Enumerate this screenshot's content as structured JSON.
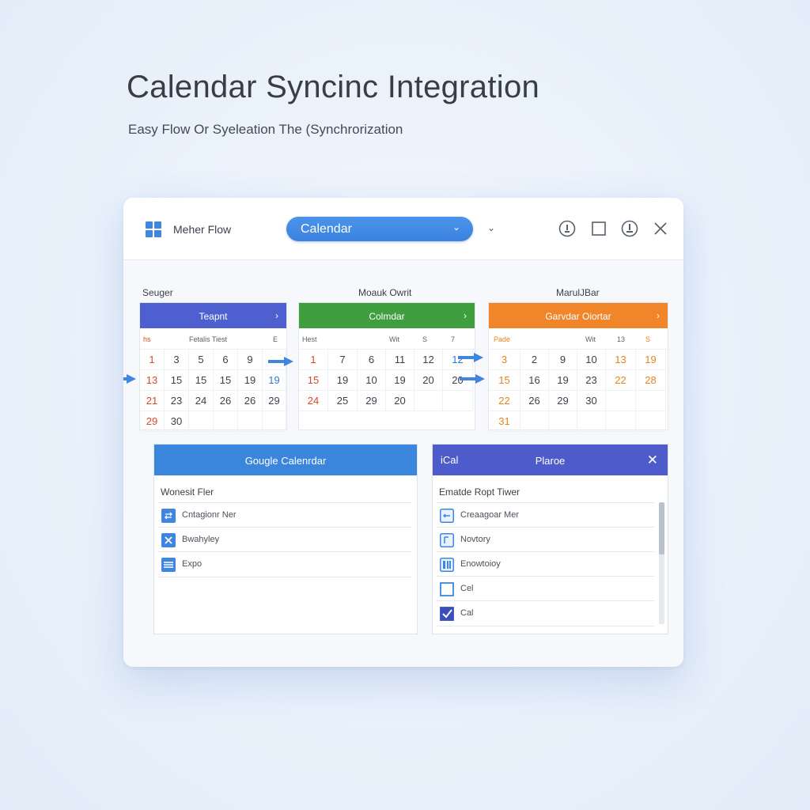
{
  "hero": {
    "title": "Calendar Syncinc Integration",
    "subtitle": "Easy Flow Or Syeleation The (Synchrorization"
  },
  "window": {
    "app_name": "Meher Flow",
    "calendar_select": "Calendar",
    "toolbar_icons": [
      "info-icon",
      "maximize-icon",
      "settings-icon",
      "close-icon"
    ]
  },
  "calendars": [
    {
      "caption": "Seuger",
      "header": "Teapnt",
      "header_color": "#4e5fcf",
      "dow": [
        "hs",
        "Fetalis Tiest",
        "E"
      ],
      "rows": [
        [
          "1",
          "3",
          "5",
          "6",
          "9",
          ""
        ],
        [
          "13",
          "15",
          "15",
          "15",
          "19",
          "19"
        ],
        [
          "21",
          "23",
          "24",
          "26",
          "26",
          "29"
        ],
        [
          "29",
          "30",
          "",
          "",
          "",
          ""
        ]
      ]
    },
    {
      "caption": "Moauk Owrit",
      "header": "Colmdar",
      "header_color": "#3f9f3f",
      "dow": [
        "Hest",
        "Wit",
        "S",
        "7"
      ],
      "rows": [
        [
          "1",
          "7",
          "6",
          "11",
          "12",
          "12"
        ],
        [
          "15",
          "19",
          "10",
          "19",
          "20",
          "20"
        ],
        [
          "24",
          "25",
          "29",
          "20",
          "",
          ""
        ]
      ]
    },
    {
      "caption": "MarulJBar",
      "header": "Garvdar Oiortar",
      "header_color": "#f0852a",
      "dow": [
        "Pade",
        "Wit",
        "13",
        "S"
      ],
      "rows": [
        [
          "3",
          "2",
          "9",
          "10",
          "13",
          "19"
        ],
        [
          "15",
          "16",
          "19",
          "23",
          "22",
          "28"
        ],
        [
          "22",
          "26",
          "29",
          "30",
          "",
          ""
        ],
        [
          "31",
          "",
          "",
          "",
          "",
          ""
        ]
      ]
    }
  ],
  "google_panel": {
    "title": "Gougle Calenrdar",
    "subtitle": "Wonesit Fler",
    "items": [
      "Cntagionr Ner",
      "Bwahyley",
      "Expo"
    ],
    "item_icons": [
      "sync-icon",
      "sparkle-icon",
      "grid-icon"
    ],
    "color": "#3a86dc"
  },
  "ical_panel": {
    "left_label": "iCal",
    "title": "Plaroe",
    "subtitle": "Ematde Ropt Tiwer",
    "items": [
      "Creaagoar Mer",
      "Novtory",
      "Enowtoioy",
      "Cel",
      "Cal"
    ],
    "item_icons": [
      "sync-icon",
      "doc-icon",
      "columns-icon",
      "checkbox-unchecked-icon",
      "checkbox-checked-icon"
    ],
    "color": "#4e5bcb"
  }
}
